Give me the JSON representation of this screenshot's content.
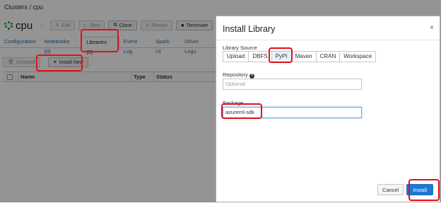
{
  "breadcrumb": "Clusters / cpu",
  "cluster": {
    "name": "cpu",
    "buttons": {
      "edit": "Edit",
      "start": "Start",
      "clone": "Clone",
      "restart": "Restart",
      "terminate": "Terminate"
    }
  },
  "tabs": [
    {
      "label": "Configuration"
    },
    {
      "label": "Notebooks (0)"
    },
    {
      "label": "Libraries (0)"
    },
    {
      "label": "Event Log"
    },
    {
      "label": "Spark UI"
    },
    {
      "label": "Driver Logs"
    }
  ],
  "libraries": {
    "uninstall_label": "Uninstall",
    "install_new_label": "Install New",
    "columns": [
      "Name",
      "Type",
      "Status"
    ]
  },
  "modal": {
    "title": "Install Library",
    "close_glyph": "×",
    "library_source_label": "Library Source",
    "sources": [
      "Upload",
      "DBFS",
      "PyPI",
      "Maven",
      "CRAN",
      "Workspace"
    ],
    "selected_source": "PyPI",
    "repository_label": "Repository",
    "repository_placeholder": "Optional",
    "package_label": "Package",
    "package_value": "azureml-sdk",
    "cancel_label": "Cancel",
    "install_label": "Install"
  },
  "colors": {
    "highlight": "#e0101a",
    "primary": "#1f78d1",
    "link": "#1f6fa9"
  }
}
